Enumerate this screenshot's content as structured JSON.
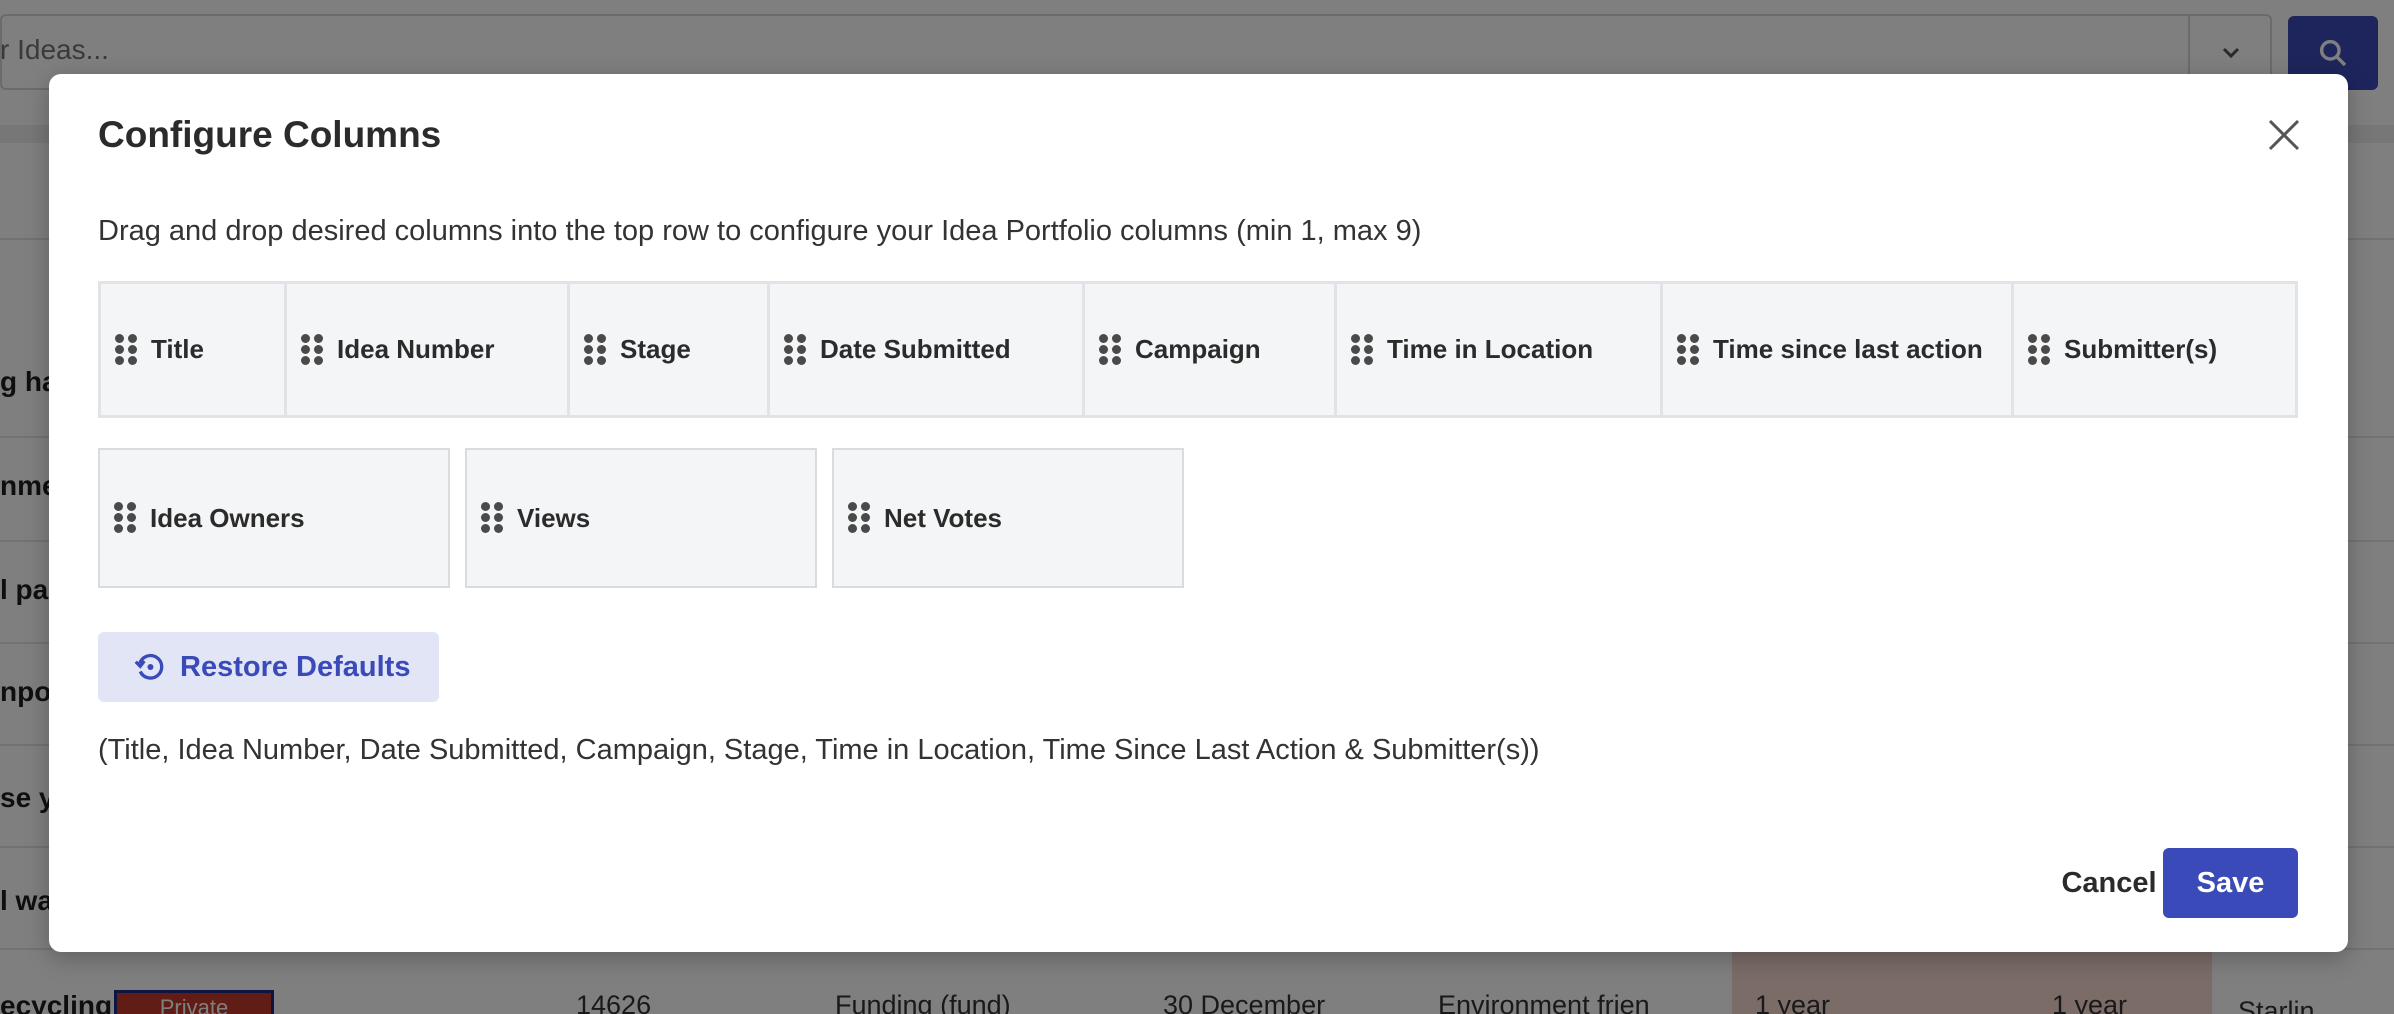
{
  "background": {
    "search_placeholder": "r Ideas...",
    "rows": [
      "g ha",
      "nme",
      "l pap",
      "npor",
      "se y",
      "l wa",
      "ecycling"
    ],
    "last_row": {
      "badge": "Private",
      "idea_number": "14626",
      "campaign": "Funding (fund)",
      "date": "30 December",
      "category": "Environment frien",
      "time_in_location": "1 year",
      "time_since_last": "1 year",
      "submitter": "Starlin"
    }
  },
  "modal": {
    "title": "Configure Columns",
    "instructions": "Drag and drop desired columns into the top row to configure your Idea Portfolio columns (min 1, max 9)",
    "active_columns": [
      {
        "label": "Title"
      },
      {
        "label": "Idea Number"
      },
      {
        "label": "Stage"
      },
      {
        "label": "Date Submitted"
      },
      {
        "label": "Campaign"
      },
      {
        "label": "Time in Location"
      },
      {
        "label": "Time since last action"
      },
      {
        "label": "Submitter(s)"
      }
    ],
    "available_columns": [
      {
        "label": "Idea Owners"
      },
      {
        "label": "Views"
      },
      {
        "label": "Net Votes"
      }
    ],
    "restore_label": "Restore Defaults",
    "defaults_note": "(Title, Idea Number, Date Submitted, Campaign, Stage, Time in Location, Time Since Last Action & Submitter(s))",
    "cancel_label": "Cancel",
    "save_label": "Save"
  },
  "colors": {
    "primary": "#3a4ab8",
    "restore_bg": "#e1e5f6",
    "chip_bg": "#f4f5f6"
  }
}
